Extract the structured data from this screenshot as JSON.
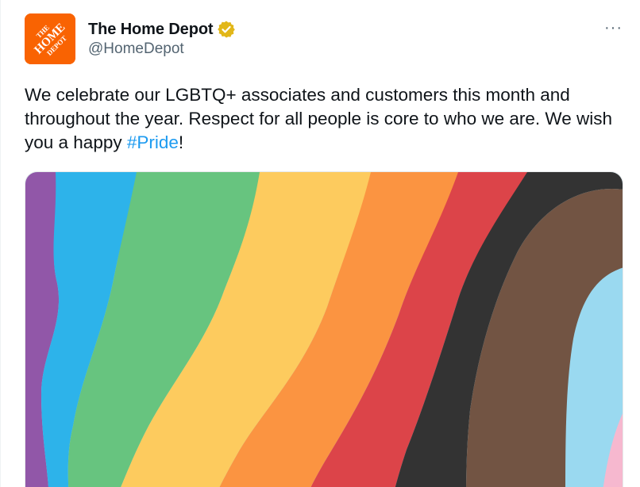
{
  "tweet": {
    "author": {
      "display_name": "The Home Depot",
      "handle": "@HomeDepot",
      "avatar_logo_lines": [
        "THE",
        "HOME",
        "DEPOT"
      ],
      "verified": true,
      "verified_badge_color": "#e2b719"
    },
    "more_label": "···",
    "text_prefix": "We celebrate our LGBTQ+ associates and customers this month and throughout the year. Respect for all people is core to who we are. We wish you a happy ",
    "hashtag": "#Pride",
    "text_suffix": "!",
    "colors": {
      "brand_orange": "#f96302",
      "link_blue": "#1d9bf0",
      "text": "#0f1419",
      "secondary_text": "#536471"
    },
    "media": {
      "type": "image",
      "description_colors": [
        "#9157a8",
        "#2db3ea",
        "#67c47f",
        "#fdcb5e",
        "#fb9441",
        "#dc4449",
        "#333333",
        "#725443",
        "#9ad9f0",
        "#f6b8cf"
      ]
    }
  }
}
